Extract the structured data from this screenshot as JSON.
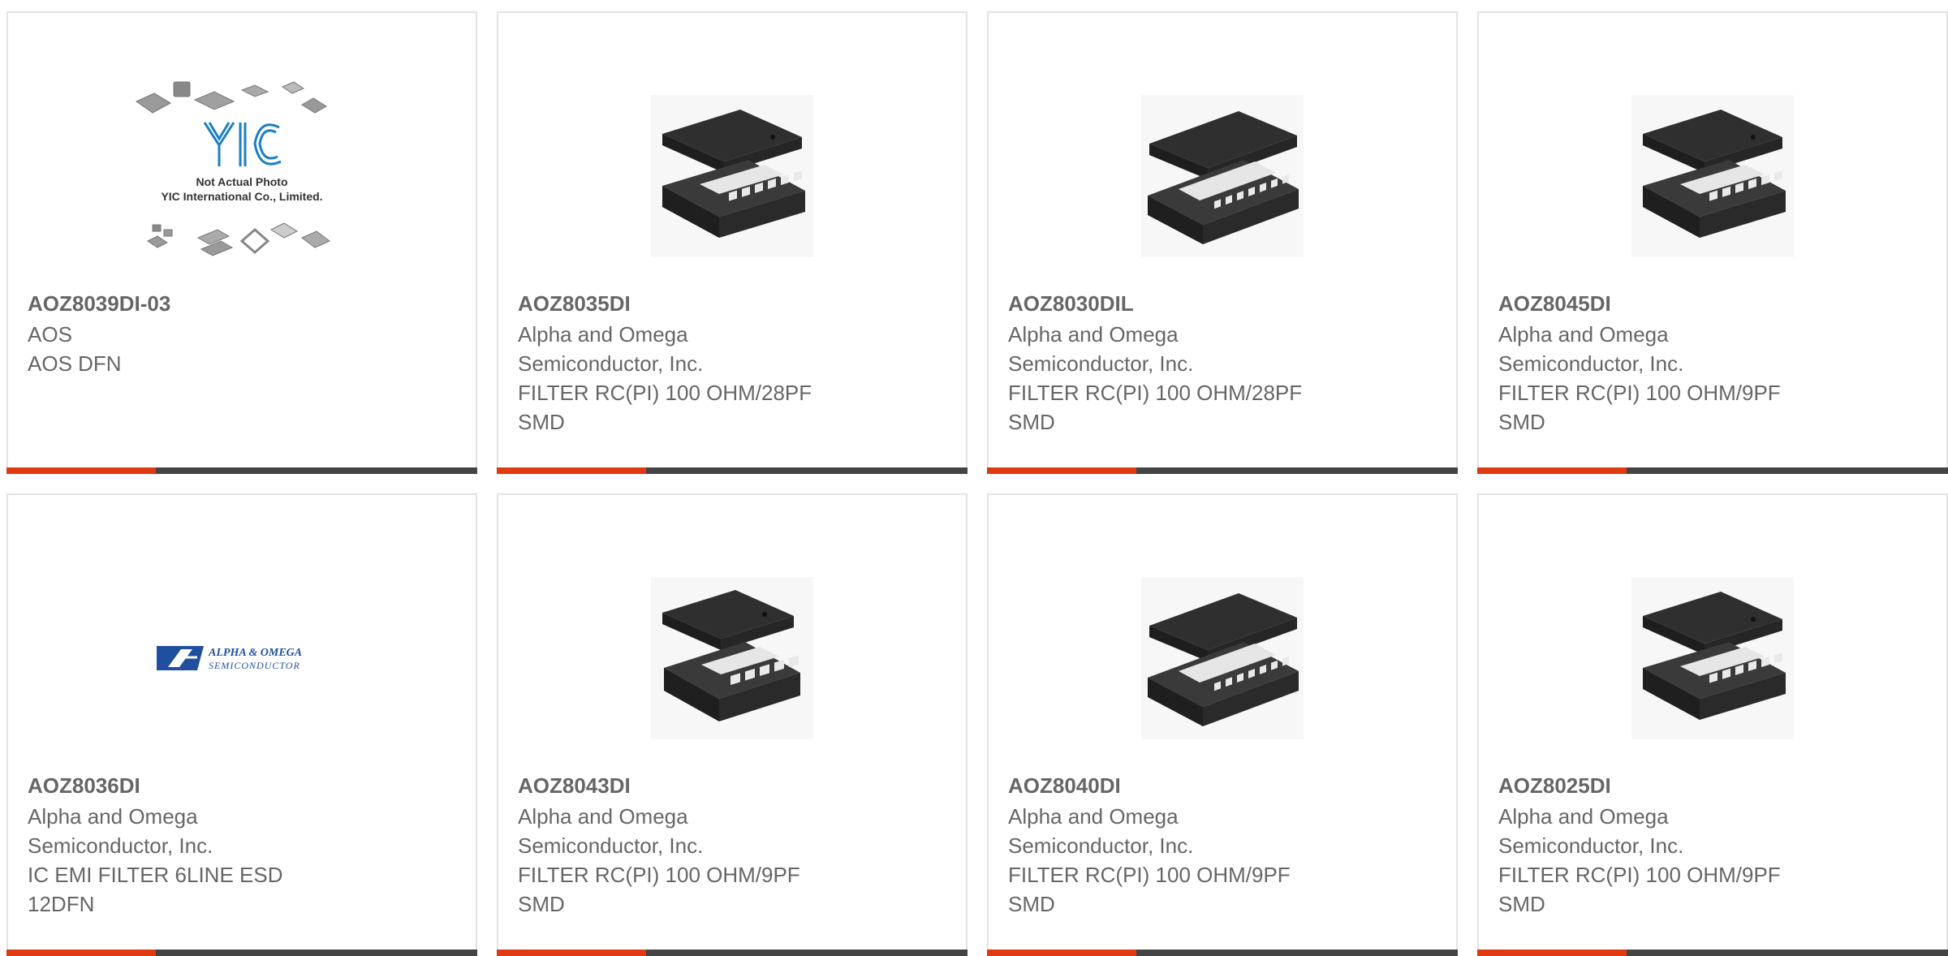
{
  "products": [
    {
      "part_number": "AOZ8039DI-03",
      "lines": [
        "AOS",
        "AOS DFN"
      ],
      "image": "placeholder",
      "image_caption": [
        "Not Actual Photo",
        "YIC International Co., Limited."
      ],
      "image_logo_text": "YIC"
    },
    {
      "part_number": "AOZ8035DI",
      "lines": [
        "Alpha and Omega",
        "Semiconductor, Inc.",
        "FILTER RC(PI) 100 OHM/28PF",
        "SMD"
      ],
      "image": "chip-14"
    },
    {
      "part_number": "AOZ8030DIL",
      "lines": [
        "Alpha and Omega",
        "Semiconductor, Inc.",
        "FILTER RC(PI) 100 OHM/28PF",
        "SMD"
      ],
      "image": "chip-18"
    },
    {
      "part_number": "AOZ8045DI",
      "lines": [
        "Alpha and Omega",
        "Semiconductor, Inc.",
        "FILTER RC(PI) 100 OHM/9PF",
        "SMD"
      ],
      "image": "chip-14"
    },
    {
      "part_number": "AOZ8036DI",
      "lines": [
        "Alpha and Omega",
        "Semiconductor, Inc.",
        "IC EMI FILTER 6LINE ESD",
        "12DFN"
      ],
      "image": "aos-logo",
      "image_logo_text": [
        "ALPHA & OMEGA",
        "SEMICONDUCTOR"
      ]
    },
    {
      "part_number": "AOZ8043DI",
      "lines": [
        "Alpha and Omega",
        "Semiconductor, Inc.",
        "FILTER RC(PI) 100 OHM/9PF",
        "SMD"
      ],
      "image": "chip-12"
    },
    {
      "part_number": "AOZ8040DI",
      "lines": [
        "Alpha and Omega",
        "Semiconductor, Inc.",
        "FILTER RC(PI) 100 OHM/9PF",
        "SMD"
      ],
      "image": "chip-18"
    },
    {
      "part_number": "AOZ8025DI",
      "lines": [
        "Alpha and Omega",
        "Semiconductor, Inc.",
        "FILTER RC(PI) 100 OHM/9PF",
        "SMD"
      ],
      "image": "chip-14"
    }
  ],
  "colors": {
    "accent": "#e03a12",
    "bar": "#444444",
    "border": "#e3e3e3",
    "text": "#666666"
  }
}
